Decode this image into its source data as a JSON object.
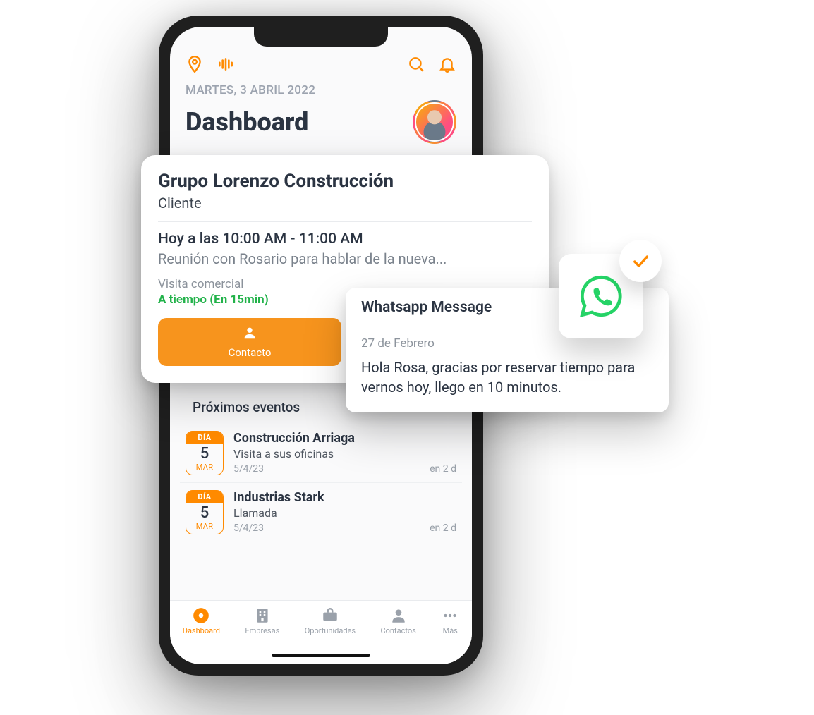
{
  "header": {
    "date_label": "MARTES, 3 ABRIL 2022",
    "title": "Dashboard"
  },
  "detail_card": {
    "company": "Grupo Lorenzo Construcción",
    "relation": "Cliente",
    "time_label": "Hoy a las 10:00 AM - 11:00 AM",
    "description": "Reunión con Rosario para hablar de la nueva...",
    "visit_type": "Visita comercial",
    "status": "A tiempo (En 15min)",
    "contact_label": "Contacto"
  },
  "whatsapp": {
    "title": "Whatsapp Message",
    "date": "27 de Febrero",
    "body": "Hola Rosa, gracias por reservar tiempo para vernos hoy, llego en 10 minutos."
  },
  "events": {
    "section_title": "Próximos eventos",
    "items": [
      {
        "day_label": "DÍA",
        "day": "5",
        "month": "MAR",
        "title": "Construcción Arriaga",
        "subtitle": "Visita a sus oficinas",
        "date_text": "5/4/23",
        "eta": "en 2 d"
      },
      {
        "day_label": "DÍA",
        "day": "5",
        "month": "MAR",
        "title": "Industrias Stark",
        "subtitle": "Llamada",
        "date_text": "5/4/23",
        "eta": "en 2 d"
      }
    ]
  },
  "tabs": {
    "dashboard": "Dashboard",
    "empresas": "Empresas",
    "oportunidades": "Oportunidades",
    "contactos": "Contactos",
    "mas": "Más"
  }
}
